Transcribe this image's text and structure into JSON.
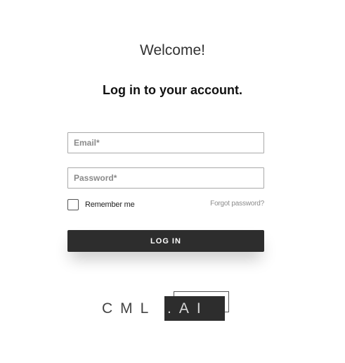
{
  "header": {
    "welcome": "Welcome!",
    "subtitle": "Log in to your account."
  },
  "form": {
    "email_placeholder": "Email*",
    "email_value": "",
    "password_placeholder": "Password*",
    "password_value": "",
    "remember_label": "Remember me",
    "remember_checked": false,
    "forgot_label": "Forgot password?",
    "submit_label": "LOG IN"
  },
  "logo": {
    "left_text": "CML",
    "right_text": ".AI"
  },
  "colors": {
    "button_bg": "#2d2d2d",
    "border": "#a9a9a9",
    "muted_text": "#8c8c8c"
  }
}
